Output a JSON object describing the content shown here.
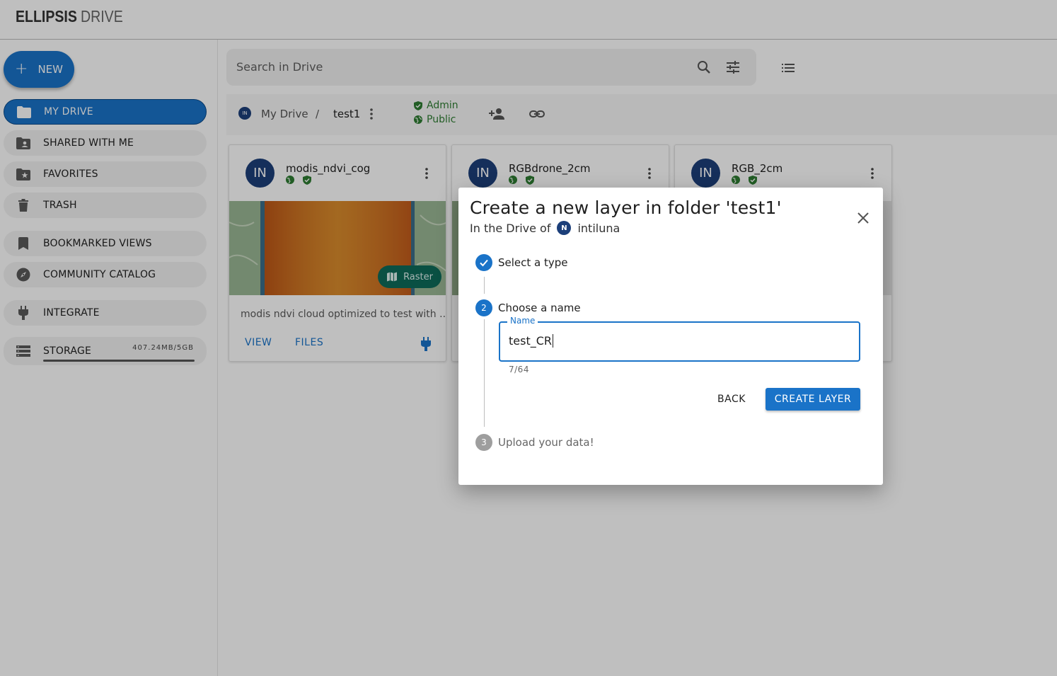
{
  "app": {
    "logo_bold": "ELLIPSIS",
    "logo_light": "DRIVE"
  },
  "sidebar": {
    "new_label": "NEW",
    "items": [
      {
        "label": "MY DRIVE",
        "icon": "folder-icon"
      },
      {
        "label": "SHARED WITH ME",
        "icon": "shared-folder-icon"
      },
      {
        "label": "FAVORITES",
        "icon": "star-folder-icon"
      },
      {
        "label": "TRASH",
        "icon": "trash-icon"
      },
      {
        "label": "BOOKMARKED VIEWS",
        "icon": "bookmark-icon"
      },
      {
        "label": "COMMUNITY CATALOG",
        "icon": "compass-icon"
      },
      {
        "label": "INTEGRATE",
        "icon": "plug-icon"
      }
    ],
    "storage": {
      "label": "STORAGE",
      "size": "407.24MB/5GB",
      "used_fraction": 0.08
    }
  },
  "search": {
    "placeholder": "Search in Drive"
  },
  "breadcrumb": {
    "avatar": "IN",
    "root": "My Drive",
    "separator": "/",
    "folder": "test1",
    "permissions": [
      "Admin",
      "Public"
    ]
  },
  "cards": [
    {
      "avatar": "IN",
      "title": "modis_ndvi_cog",
      "type_chip": "Raster",
      "description": "modis ndvi cloud optimized to test with ...",
      "actions": [
        "VIEW",
        "FILES"
      ]
    },
    {
      "avatar": "IN",
      "title": "RGBdrone_2cm"
    },
    {
      "avatar": "IN",
      "title": "RGB_2cm"
    }
  ],
  "dialog": {
    "title": "Create a new layer in folder 'test1'",
    "subtitle_prefix": "In the Drive of",
    "owner_avatar": "N",
    "owner": "intiluna",
    "steps": [
      {
        "number": "1",
        "label": "Select a type",
        "state": "done"
      },
      {
        "number": "2",
        "label": "Choose a name",
        "state": "active"
      },
      {
        "number": "3",
        "label": "Upload your data!",
        "state": "pending"
      }
    ],
    "name_field": {
      "label": "Name",
      "value": "test_CR",
      "counter": "7/64"
    },
    "back_label": "BACK",
    "create_label": "CREATE LAYER"
  },
  "colors": {
    "primary": "#1a73c8",
    "success": "#2e7d32",
    "raster_chip": "#0e6b5a",
    "avatar": "#1c3f7a"
  }
}
